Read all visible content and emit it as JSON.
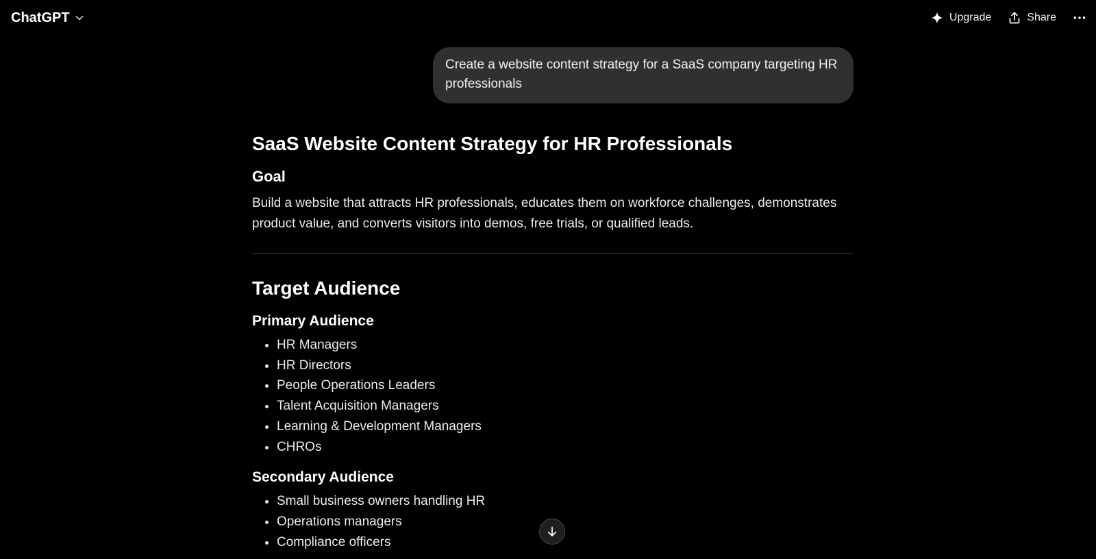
{
  "header": {
    "app_title": "ChatGPT",
    "upgrade_label": "Upgrade",
    "share_label": "Share"
  },
  "conversation": {
    "user_message": "Create a website content strategy for a SaaS company targeting HR professionals",
    "assistant": {
      "title": "SaaS Website Content Strategy for HR Professionals",
      "goal_heading": "Goal",
      "goal_text": "Build a website that attracts HR professionals, educates them on workforce challenges, demonstrates product value, and converts visitors into demos, free trials, or qualified leads.",
      "target_heading": "Target Audience",
      "primary_heading": "Primary Audience",
      "primary_items": [
        "HR Managers",
        "HR Directors",
        "People Operations Leaders",
        "Talent Acquisition Managers",
        "Learning & Development Managers",
        "CHROs"
      ],
      "secondary_heading": "Secondary Audience",
      "secondary_items": [
        "Small business owners handling HR",
        "Operations managers",
        "Compliance officers"
      ]
    }
  },
  "icons": {
    "brand_chevron": "chevron-down-icon",
    "upgrade": "sparkle-icon",
    "share": "share-icon",
    "more": "more-horizontal-icon",
    "scroll": "arrow-down-icon"
  },
  "colors": {
    "background": "#000000",
    "bubble": "#303030",
    "text": "#ececec",
    "divider": "#3a3a3a"
  }
}
